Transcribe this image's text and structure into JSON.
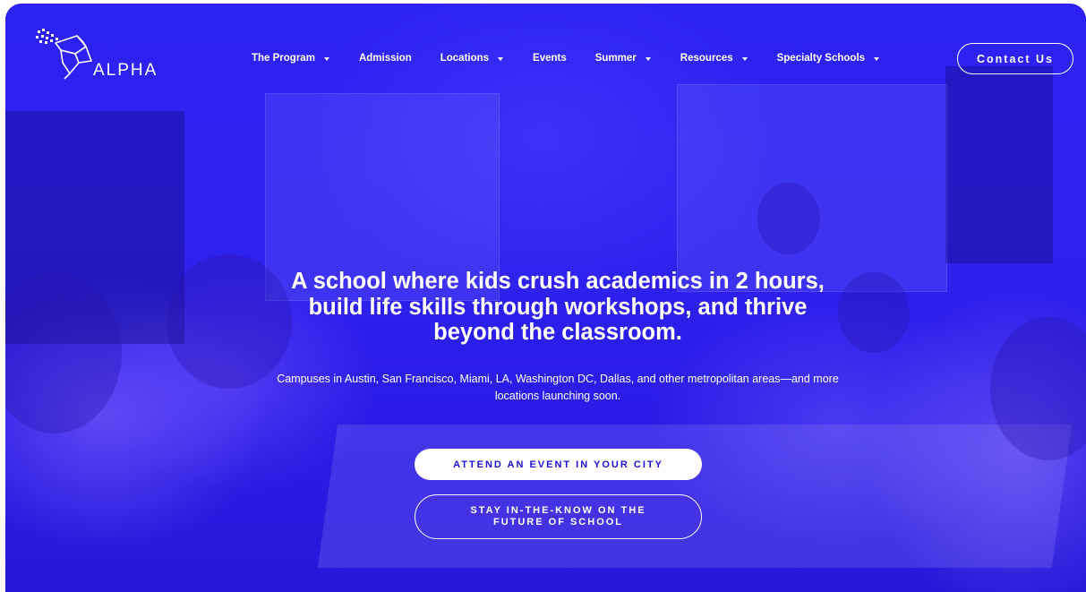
{
  "brand": {
    "name": "ALPHA"
  },
  "nav": {
    "items": [
      {
        "label": "The Program",
        "has_dropdown": true
      },
      {
        "label": "Admission",
        "has_dropdown": false
      },
      {
        "label": "Locations",
        "has_dropdown": true
      },
      {
        "label": "Events",
        "has_dropdown": false
      },
      {
        "label": "Summer",
        "has_dropdown": true
      },
      {
        "label": "Resources",
        "has_dropdown": true
      },
      {
        "label": "Specialty Schools",
        "has_dropdown": true
      }
    ],
    "contact_label": "Contact Us"
  },
  "hero": {
    "title": "A school where kids crush academics in 2 hours, build life skills through workshops, and thrive beyond the classroom.",
    "subtitle": "Campuses in Austin, San Francisco, Miami, LA, Washington DC, Dallas, and other metropolitan areas—and more locations launching soon.",
    "primary_cta": "ATTEND AN EVENT IN YOUR CITY",
    "secondary_cta": "STAY IN-THE-KNOW ON THE FUTURE OF SCHOOL"
  },
  "colors": {
    "hero_overlay": "#2a1ef2",
    "primary_button_text": "#1e10d6",
    "text": "#ffffff"
  },
  "icons": {
    "logo": "origami-bird-icon",
    "dropdown": "caret-down-icon"
  }
}
